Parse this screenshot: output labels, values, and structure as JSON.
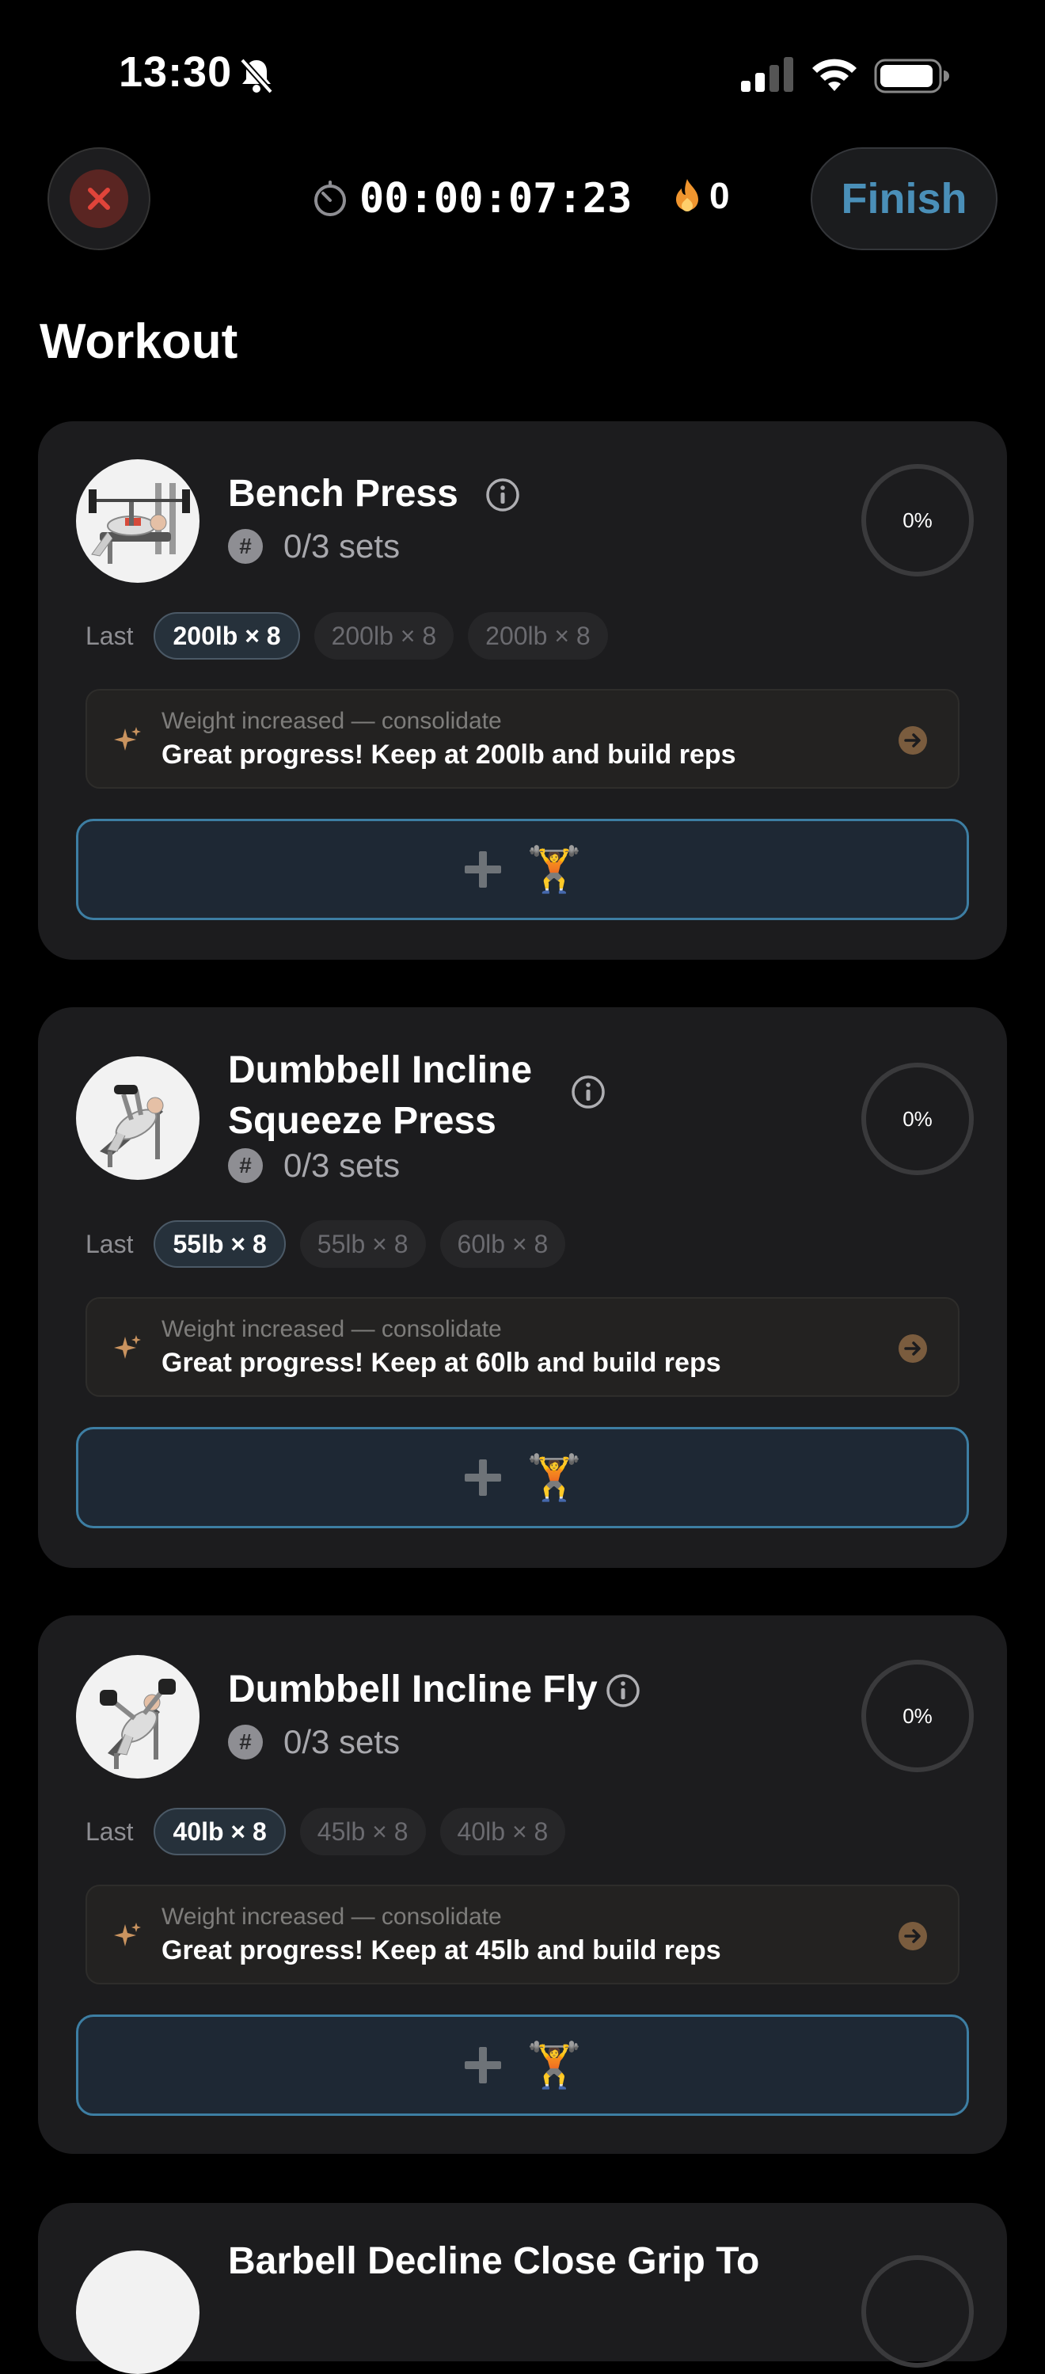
{
  "status_bar": {
    "time": "13:30"
  },
  "header": {
    "timer": "00:00:07:23",
    "streak_count": "0",
    "finish_label": "Finish"
  },
  "page_title": "Workout",
  "exercises": [
    {
      "name_line1": "Bench Press",
      "name_line2": "",
      "sets_text": "0/3 sets",
      "progress_text": "0%",
      "progress_fraction": 0,
      "last_label": "Last",
      "history": [
        "200lb × 8",
        "200lb × 8",
        "200lb × 8"
      ],
      "tip_subtitle": "Weight increased — consolidate",
      "tip_text": "Great progress! Keep at 200lb and build reps",
      "add_icon": "plus-icon",
      "lift_emoji": "🏋️"
    },
    {
      "name_line1": "Dumbbell Incline",
      "name_line2": "Squeeze Press",
      "sets_text": "0/3 sets",
      "progress_text": "0%",
      "progress_fraction": 0,
      "last_label": "Last",
      "history": [
        "55lb × 8",
        "55lb × 8",
        "60lb × 8"
      ],
      "tip_subtitle": "Weight increased — consolidate",
      "tip_text": "Great progress! Keep at 60lb and build reps",
      "add_icon": "plus-icon",
      "lift_emoji": "🏋️"
    },
    {
      "name_line1": "Dumbbell Incline Fly",
      "name_line2": "",
      "sets_text": "0/3 sets",
      "progress_text": "0%",
      "progress_fraction": 0,
      "last_label": "Last",
      "history": [
        "40lb × 8",
        "45lb × 8",
        "40lb × 8"
      ],
      "tip_subtitle": "Weight increased — consolidate",
      "tip_text": "Great progress! Keep at 45lb and build reps",
      "add_icon": "plus-icon",
      "lift_emoji": "🏋️"
    },
    {
      "name_line1": "Barbell Decline Close Grip To"
    }
  ],
  "colors": {
    "background": "#000000",
    "card": "#1c1c1e",
    "accent_blue": "#4a8fb8",
    "close_red": "#e0443a",
    "flame_orange": "#f0952e",
    "tip_arrow": "#b8865a"
  }
}
